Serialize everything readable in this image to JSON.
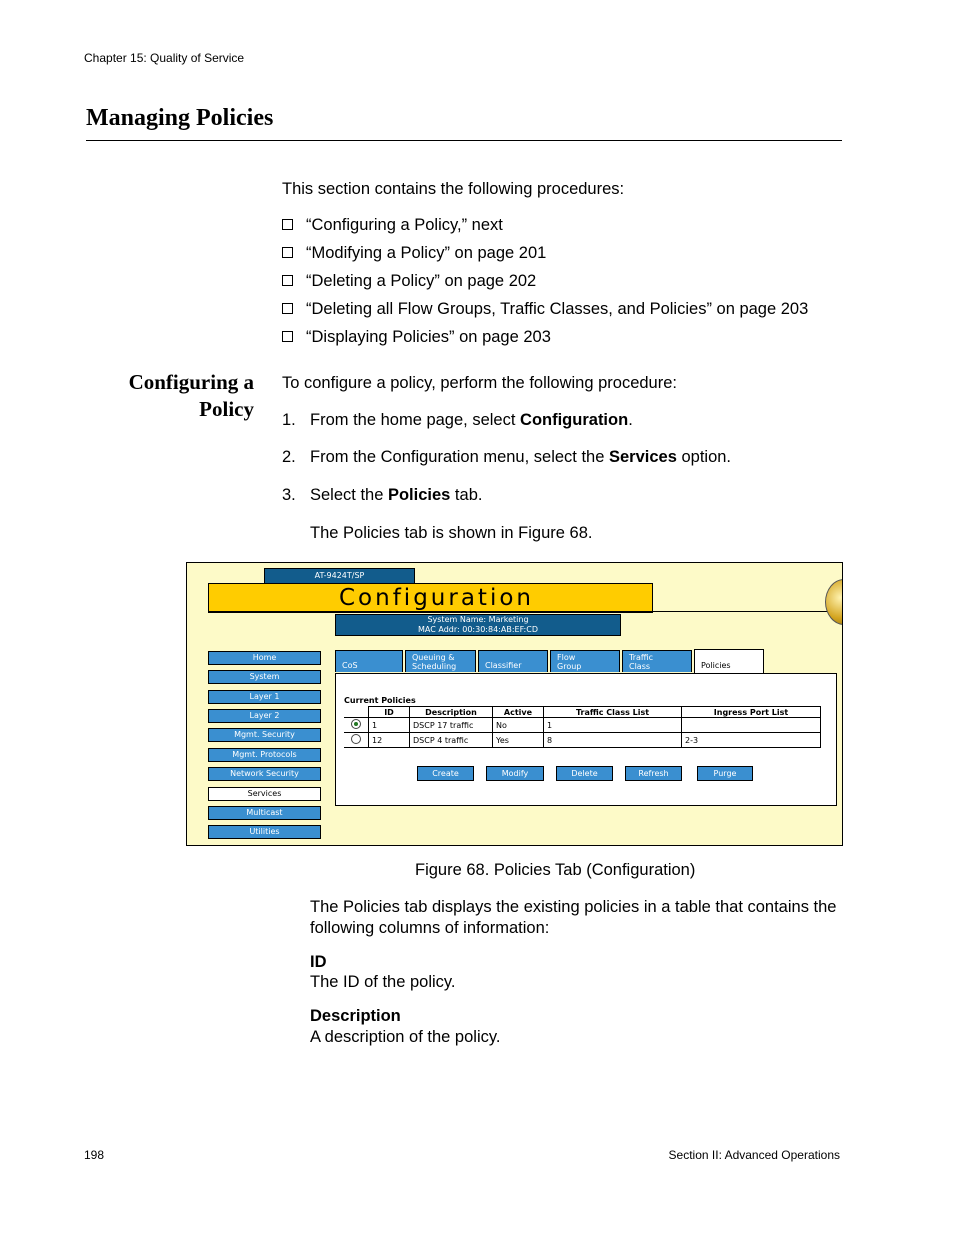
{
  "header": {
    "chapter": "Chapter 15: Quality of Service"
  },
  "section_title": "Managing Policies",
  "intro": "This section contains the following procedures:",
  "procedures": [
    "“Configuring a Policy,”  next",
    "“Modifying a Policy” on page 201",
    "“Deleting a Policy” on page 202",
    "“Deleting all Flow Groups, Traffic Classes, and Policies” on page 203",
    "“Displaying Policies” on page 203"
  ],
  "subsection": {
    "line1": "Configuring a",
    "line2": "Policy"
  },
  "config_intro": "To configure a policy, perform the following procedure:",
  "steps": [
    {
      "num": "1.",
      "pre": "From the home page, select ",
      "bold": "Configuration",
      "post": "."
    },
    {
      "num": "2.",
      "pre": "From the Configuration menu, select the ",
      "bold": "Services",
      "post": " option."
    },
    {
      "num": "3.",
      "pre": "Select the ",
      "bold": "Policies",
      "post": " tab."
    }
  ],
  "figure_ref": "The Policies tab is shown in Figure 68.",
  "screenshot": {
    "model": "AT-9424T/SP",
    "banner": "Configuration",
    "system_name": "System Name: Marketing",
    "mac_addr": "MAC Addr: 00:30:84:AB:EF:CD",
    "nav": [
      "Home",
      "System",
      "Layer 1",
      "Layer 2",
      "Mgmt. Security",
      "Mgmt. Protocols",
      "Network Security",
      "Services",
      "Multicast",
      "Utilities"
    ],
    "nav_selected": "Services",
    "tabs": [
      {
        "l1": "CoS",
        "l2": ""
      },
      {
        "l1": "Queuing &",
        "l2": "Scheduling"
      },
      {
        "l1": "Classifier",
        "l2": ""
      },
      {
        "l1": "Flow",
        "l2": "Group"
      },
      {
        "l1": "Traffic",
        "l2": "Class"
      },
      {
        "l1": "Policies",
        "l2": ""
      }
    ],
    "current_policies_label": "Current Policies",
    "columns": [
      "ID",
      "Description",
      "Active",
      "Traffic Class List",
      "Ingress Port List"
    ],
    "rows": [
      {
        "selected": true,
        "id": "1",
        "description": "DSCP 17 traffic",
        "active": "No",
        "traffic": "1",
        "ports": ""
      },
      {
        "selected": false,
        "id": "12",
        "description": "DSCP 4 traffic",
        "active": "Yes",
        "traffic": "8",
        "ports": "2-3"
      }
    ],
    "buttons": [
      "Create",
      "Modify",
      "Delete",
      "Refresh",
      "Purge"
    ]
  },
  "caption": "Figure 68. Policies Tab (Configuration)",
  "body_text": "The Policies tab displays the existing policies in a table that contains the following columns of information:",
  "definitions": [
    {
      "term": "ID",
      "desc": "The ID of the policy."
    },
    {
      "term": "Description",
      "desc": "A description of the policy."
    }
  ],
  "footer": {
    "page": "198",
    "section": "Section II: Advanced Operations"
  }
}
